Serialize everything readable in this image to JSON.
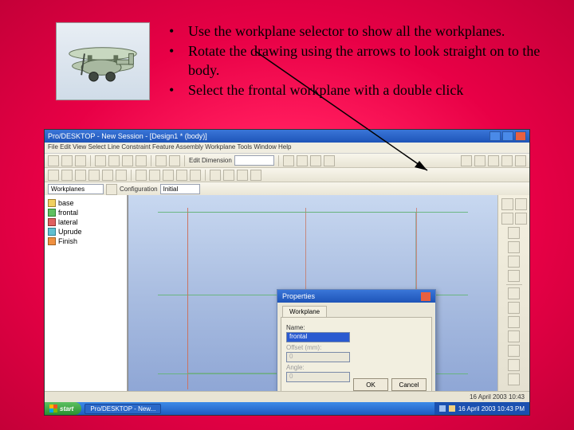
{
  "instructions": {
    "items": [
      "Use the workplane selector to show all the workplanes.",
      "Rotate the drawing using the arrows to look straight on to the body.",
      "Select the frontal workplane with a double click"
    ]
  },
  "app": {
    "title": "Pro/DESKTOP - New Session - [Design1 * (body)]",
    "menu": "File  Edit  View  Select  Line  Constraint  Feature  Assembly  Workplane  Tools  Window  Help",
    "toolbar_text": "Edit Dimension",
    "selector_label": "Workplanes",
    "config_label": "Configuration",
    "config_value": "Initial"
  },
  "tree": {
    "items": [
      {
        "label": "base",
        "color": "ico-yellow"
      },
      {
        "label": "frontal",
        "color": "ico-green"
      },
      {
        "label": "lateral",
        "color": "ico-red"
      },
      {
        "label": "Uprude",
        "color": "ico-cyan"
      },
      {
        "label": "Finish",
        "color": "ico-orange"
      }
    ]
  },
  "dialog": {
    "title": "Properties",
    "tab": "Workplane",
    "name_label": "Name:",
    "name_value": "frontal",
    "offset_label": "Offset (mm):",
    "offset_value": "0",
    "angle_label": "Angle:",
    "angle_value": "0",
    "ok": "OK",
    "cancel": "Cancel"
  },
  "taskbar": {
    "start": "start",
    "task1": "Pro/DESKTOP - New...",
    "tray_time": "16 April 2003  10:43 PM",
    "status_date": "16 April 2003  10:43"
  }
}
